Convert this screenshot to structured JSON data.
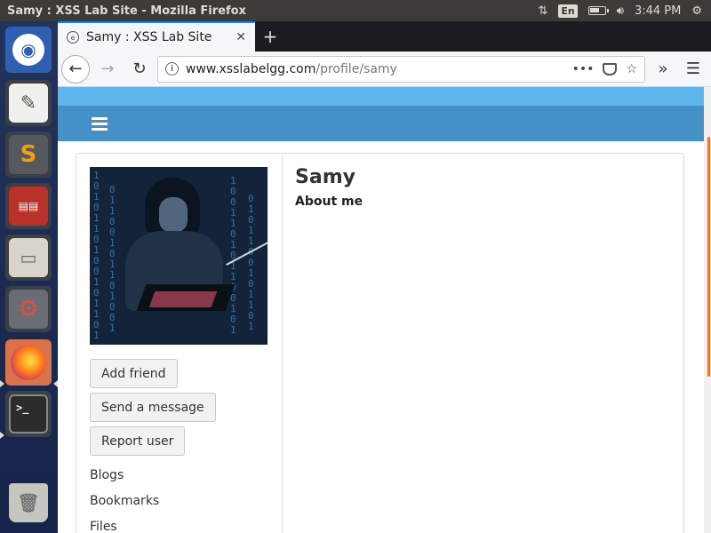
{
  "os": {
    "window_title": "Samy : XSS Lab Site - Mozilla Firefox",
    "lang": "En",
    "clock": "3:44 PM"
  },
  "launcher": {
    "items": [
      "ubuntu-dash",
      "text-editor",
      "sublime-text",
      "terminal-emulator",
      "file-manager",
      "system-settings",
      "firefox",
      "terminal",
      "trash"
    ]
  },
  "browser": {
    "tab_title": "Samy : XSS Lab Site",
    "url_host": "www.xsslabelgg.com",
    "url_path": "/profile/samy",
    "page_actions": "•••"
  },
  "profile": {
    "name": "Samy",
    "about_label": "About me",
    "buttons": {
      "add_friend": "Add friend",
      "send_message": "Send a message",
      "report_user": "Report user"
    },
    "links": [
      "Blogs",
      "Bookmarks",
      "Files"
    ]
  },
  "colors": {
    "site_top": "#5fb6ed",
    "site_nav": "#4690c8",
    "tab_accent": "#0a84ff"
  }
}
